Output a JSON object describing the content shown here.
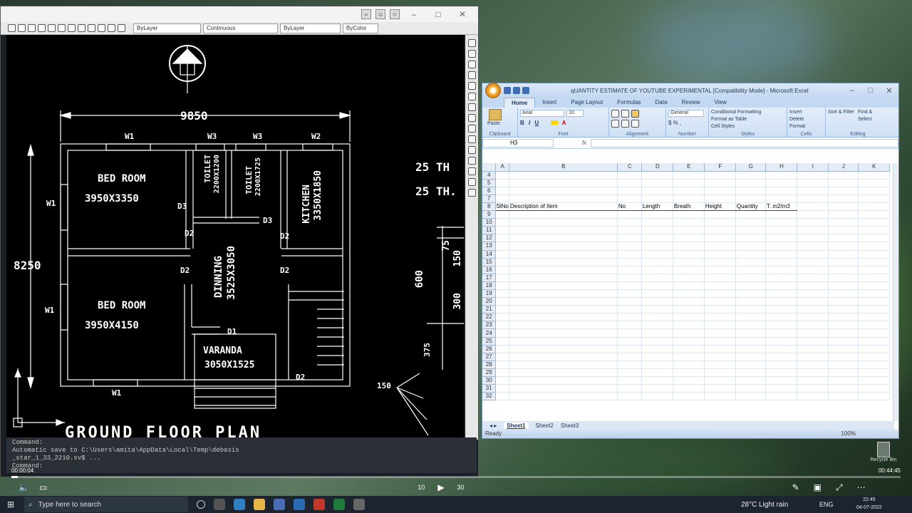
{
  "cad": {
    "layer_dropdown": "ByLayer",
    "linetype_dropdown": "Continuous",
    "lineweight_dropdown": "ByLayer",
    "color_dropdown": "ByColor",
    "command_lines": [
      "Command:",
      "Automatic save to C:\\Users\\amita\\AppData\\Local\\Temp\\debasis",
      "_star_1_33_2210.sv$ ...",
      "Command:",
      "Command:"
    ],
    "drawing": {
      "total_width": "9850",
      "total_height": "8250",
      "rooms": [
        {
          "name": "BED ROOM",
          "size": "3950X3350"
        },
        {
          "name": "TOILET",
          "size": "2200X1200"
        },
        {
          "name": "TOILET",
          "size": "2200X1725"
        },
        {
          "name": "KITCHEN",
          "size": "3350X1850"
        },
        {
          "name": "DINNING",
          "size": "3525X3050"
        },
        {
          "name": "BED ROOM",
          "size": "3950X4150"
        },
        {
          "name": "VARANDA",
          "size": "3050X1525"
        }
      ],
      "labels": [
        "W1",
        "W3",
        "W3",
        "W2",
        "W1",
        "W1",
        "W1",
        "D3",
        "D3",
        "D2",
        "D2",
        "D2",
        "D2",
        "D2",
        "D1"
      ],
      "right_texts": [
        "25 TH",
        "25 TH.",
        "75",
        "150",
        "600",
        "300",
        "375",
        "150"
      ],
      "footer_title": "GROUND FLOOR PLAN"
    }
  },
  "excel": {
    "title": "qUANTITY ESTIMATE OF YOUTUBE EXPERIMENTAL [Compatibility Mode] - Microsoft Excel",
    "tabs": [
      "Home",
      "Insert",
      "Page Layout",
      "Formulas",
      "Data",
      "Review",
      "View"
    ],
    "ribbon": {
      "paste": "Paste",
      "clipboard": "Clipboard",
      "font_name": "Arial",
      "font_size": "10",
      "font": "Font",
      "alignment": "Alignment",
      "number_format": "General",
      "number": "Number",
      "conditional": "Conditional Formatting",
      "format_table": "Format as Table",
      "cell_styles": "Cell Styles",
      "styles": "Styles",
      "insert": "Insert",
      "delete": "Delete",
      "format": "Format",
      "cells": "Cells",
      "sort": "Sort & Filter",
      "find": "Find & Select",
      "editing": "Editing"
    },
    "name_box": "H3",
    "columns": [
      "A",
      "B",
      "C",
      "D",
      "E",
      "F",
      "G",
      "H",
      "I",
      "J",
      "K"
    ],
    "header_row": {
      "row": "8",
      "cells": [
        "SlNo",
        "Description of Item",
        "No",
        "Length",
        "Breath",
        "Height",
        "Quantity",
        "T. m2/m3",
        "",
        "",
        ""
      ]
    },
    "rows_before": [
      "4",
      "5",
      "6",
      "7"
    ],
    "rows_after": [
      "9",
      "10",
      "11",
      "12",
      "13",
      "14",
      "15",
      "16",
      "17",
      "18",
      "19",
      "20",
      "21",
      "22",
      "23",
      "24",
      "25",
      "26",
      "27",
      "28",
      "29",
      "30",
      "31",
      "32"
    ],
    "sheets": [
      "Sheet1",
      "Sheet2",
      "Sheet3"
    ],
    "status": "Ready",
    "zoom": "100%"
  },
  "video": {
    "time_elapsed": "00:00:04",
    "time_total": "00:44:45",
    "skip_back": "10",
    "skip_forward": "30"
  },
  "taskbar": {
    "search_placeholder": "Type here to search",
    "weather": "28°C  Light rain",
    "lang": "ENG",
    "time": "22:45",
    "date": "04-07-2022",
    "recycle": "Recycle Bin"
  }
}
